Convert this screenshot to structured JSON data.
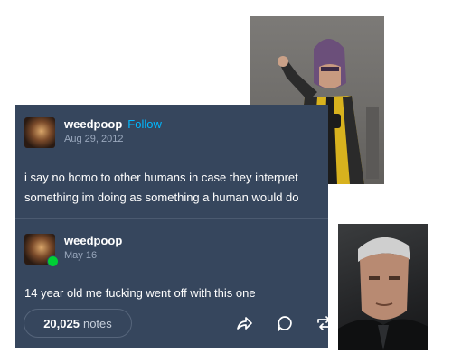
{
  "original_post": {
    "username": "weedpoop",
    "follow_label": "Follow",
    "date": "Aug 29, 2012",
    "text_line1": "i say no homo to other humans in case they interpret",
    "text_line2": "something im doing as something a human would do"
  },
  "reblog": {
    "username": "weedpoop",
    "date": "May 16",
    "text": "14 year old me fucking went off with this one"
  },
  "footer": {
    "notes_count": "20,025",
    "notes_label": "notes"
  },
  "icons": [
    "share-icon",
    "reply-icon",
    "reblog-icon"
  ],
  "colors": {
    "card_background": "#36465d",
    "follow_link": "#00b8ff",
    "reblog_badge": "#00cf35"
  }
}
